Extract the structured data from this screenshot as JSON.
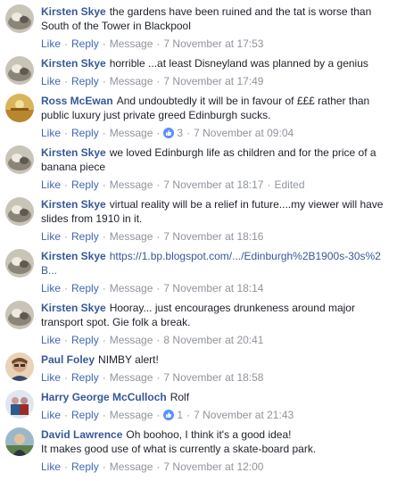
{
  "actions": {
    "like": "Like",
    "reply": "Reply",
    "message": "Message",
    "edited": "Edited"
  },
  "comments": [
    {
      "author": "Kirsten Skye",
      "text": "the gardens have been ruined and the tat is worse than South of the Tower in Blackpool",
      "time": "7 November at 17:53"
    },
    {
      "author": "Kirsten Skye",
      "text": "horrible ...at least Disneyland was planned by a genius",
      "time": "7 November at 17:49"
    },
    {
      "author": "Ross McEwan",
      "text": "And undoubtedly it will be in favour of £££ rather than public luxury just private greed Edinburgh sucks.",
      "time": "7 November at 09:04",
      "reactions": "3"
    },
    {
      "author": "Kirsten Skye",
      "text": "we loved Edinburgh life as children and for the price of a banana piece",
      "time": "7 November at 18:17"
    },
    {
      "author": "Kirsten Skye",
      "text": "virtual reality will be a relief in future....my viewer will have slides from 1910 in it.",
      "time": "7 November at 18:16"
    },
    {
      "author": "Kirsten Skye",
      "text": "https://1.bp.blogspot.com/.../Edinburgh%2B1900s-30s%2B...",
      "time": "7 November at 18:14"
    },
    {
      "author": "Kirsten Skye",
      "text": "Hooray... just encourages drunkeness around major transport spot. Gie folk a break.",
      "time": "8 November at 20:41"
    },
    {
      "author": "Paul Foley",
      "text": "NIMBY alert!",
      "time": "7 November at 18:58"
    },
    {
      "author": "Harry George McCulloch",
      "text": "Rolf",
      "time": "7 November at 21:43",
      "reactions": "1"
    },
    {
      "author": "David Lawrence",
      "text": "Oh boohoo, I think it's a good idea!",
      "text2": "It makes good use of what is currently a skate-board park.",
      "time": "7 November at 12:00"
    }
  ],
  "colors": {
    "author": "#365899",
    "action": "#4267b2",
    "meta": "#90949c",
    "reaction": "#5890ff"
  }
}
